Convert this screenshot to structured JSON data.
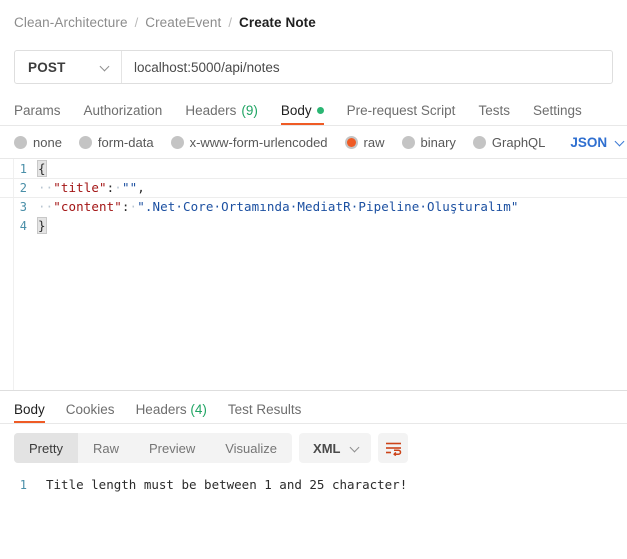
{
  "breadcrumb": {
    "items": [
      {
        "label": "Clean-Architecture",
        "current": false
      },
      {
        "label": "CreateEvent",
        "current": false
      },
      {
        "label": "Create Note",
        "current": true
      }
    ],
    "separator": "/"
  },
  "request": {
    "method": "POST",
    "method_chevron_icon": "chevron-down-icon",
    "url": "localhost:5000/api/notes",
    "url_placeholder": "Enter request URL",
    "tabs": [
      {
        "label": "Params",
        "active": false
      },
      {
        "label": "Authorization",
        "active": false
      },
      {
        "label": "Headers",
        "count": "(9)",
        "active": false
      },
      {
        "label": "Body",
        "active": true,
        "dot": "green-dot-icon"
      },
      {
        "label": "Pre-request Script",
        "active": false
      },
      {
        "label": "Tests",
        "active": false
      },
      {
        "label": "Settings",
        "active": false
      }
    ],
    "body_types": [
      {
        "label": "none",
        "selected": false
      },
      {
        "label": "form-data",
        "selected": false
      },
      {
        "label": "x-www-form-urlencoded",
        "selected": false
      },
      {
        "label": "raw",
        "selected": true
      },
      {
        "label": "binary",
        "selected": false
      },
      {
        "label": "GraphQL",
        "selected": false
      }
    ],
    "raw_format": {
      "label": "JSON",
      "chevron_icon": "chevron-down-icon"
    },
    "editor": {
      "lines": [
        {
          "no": "1",
          "text": "{"
        },
        {
          "no": "2",
          "text": "  \"title\": \"\","
        },
        {
          "no": "3",
          "text": "  \"content\": \".Net Core Ortamında MediatR Pipeline Oluşturalım\""
        },
        {
          "no": "4",
          "text": "}"
        }
      ],
      "key_title": "\"title\"",
      "value_title": "\"\"",
      "key_content": "\"content\"",
      "value_content": "\".Net·Core·Ortamında·MediatR·Pipeline·Oluşturalım\"",
      "brace_open": "{",
      "brace_close": "}",
      "comma": ",",
      "colon": ":"
    }
  },
  "response": {
    "tabs": [
      {
        "label": "Body",
        "active": true
      },
      {
        "label": "Cookies",
        "active": false
      },
      {
        "label": "Headers",
        "count": "(4)",
        "active": false
      },
      {
        "label": "Test Results",
        "active": false
      }
    ],
    "view_modes": [
      {
        "label": "Pretty",
        "active": true
      },
      {
        "label": "Raw",
        "active": false
      },
      {
        "label": "Preview",
        "active": false
      },
      {
        "label": "Visualize",
        "active": false
      }
    ],
    "format": {
      "label": "XML",
      "chevron_icon": "chevron-down-icon"
    },
    "wrap_lines_icon": "wrap-lines-icon",
    "body": {
      "lines": [
        {
          "no": "1",
          "text": "Title length must be between 1 and 25 character!"
        }
      ]
    }
  },
  "colors": {
    "accent_orange": "#ef5b25",
    "status_green": "#2bb673",
    "count_green": "#1fa463",
    "link_blue": "#2f6fd0",
    "gutter_blue": "#4a8fa8",
    "json_key_red": "#a31515",
    "json_string_blue": "#1c50a1"
  }
}
